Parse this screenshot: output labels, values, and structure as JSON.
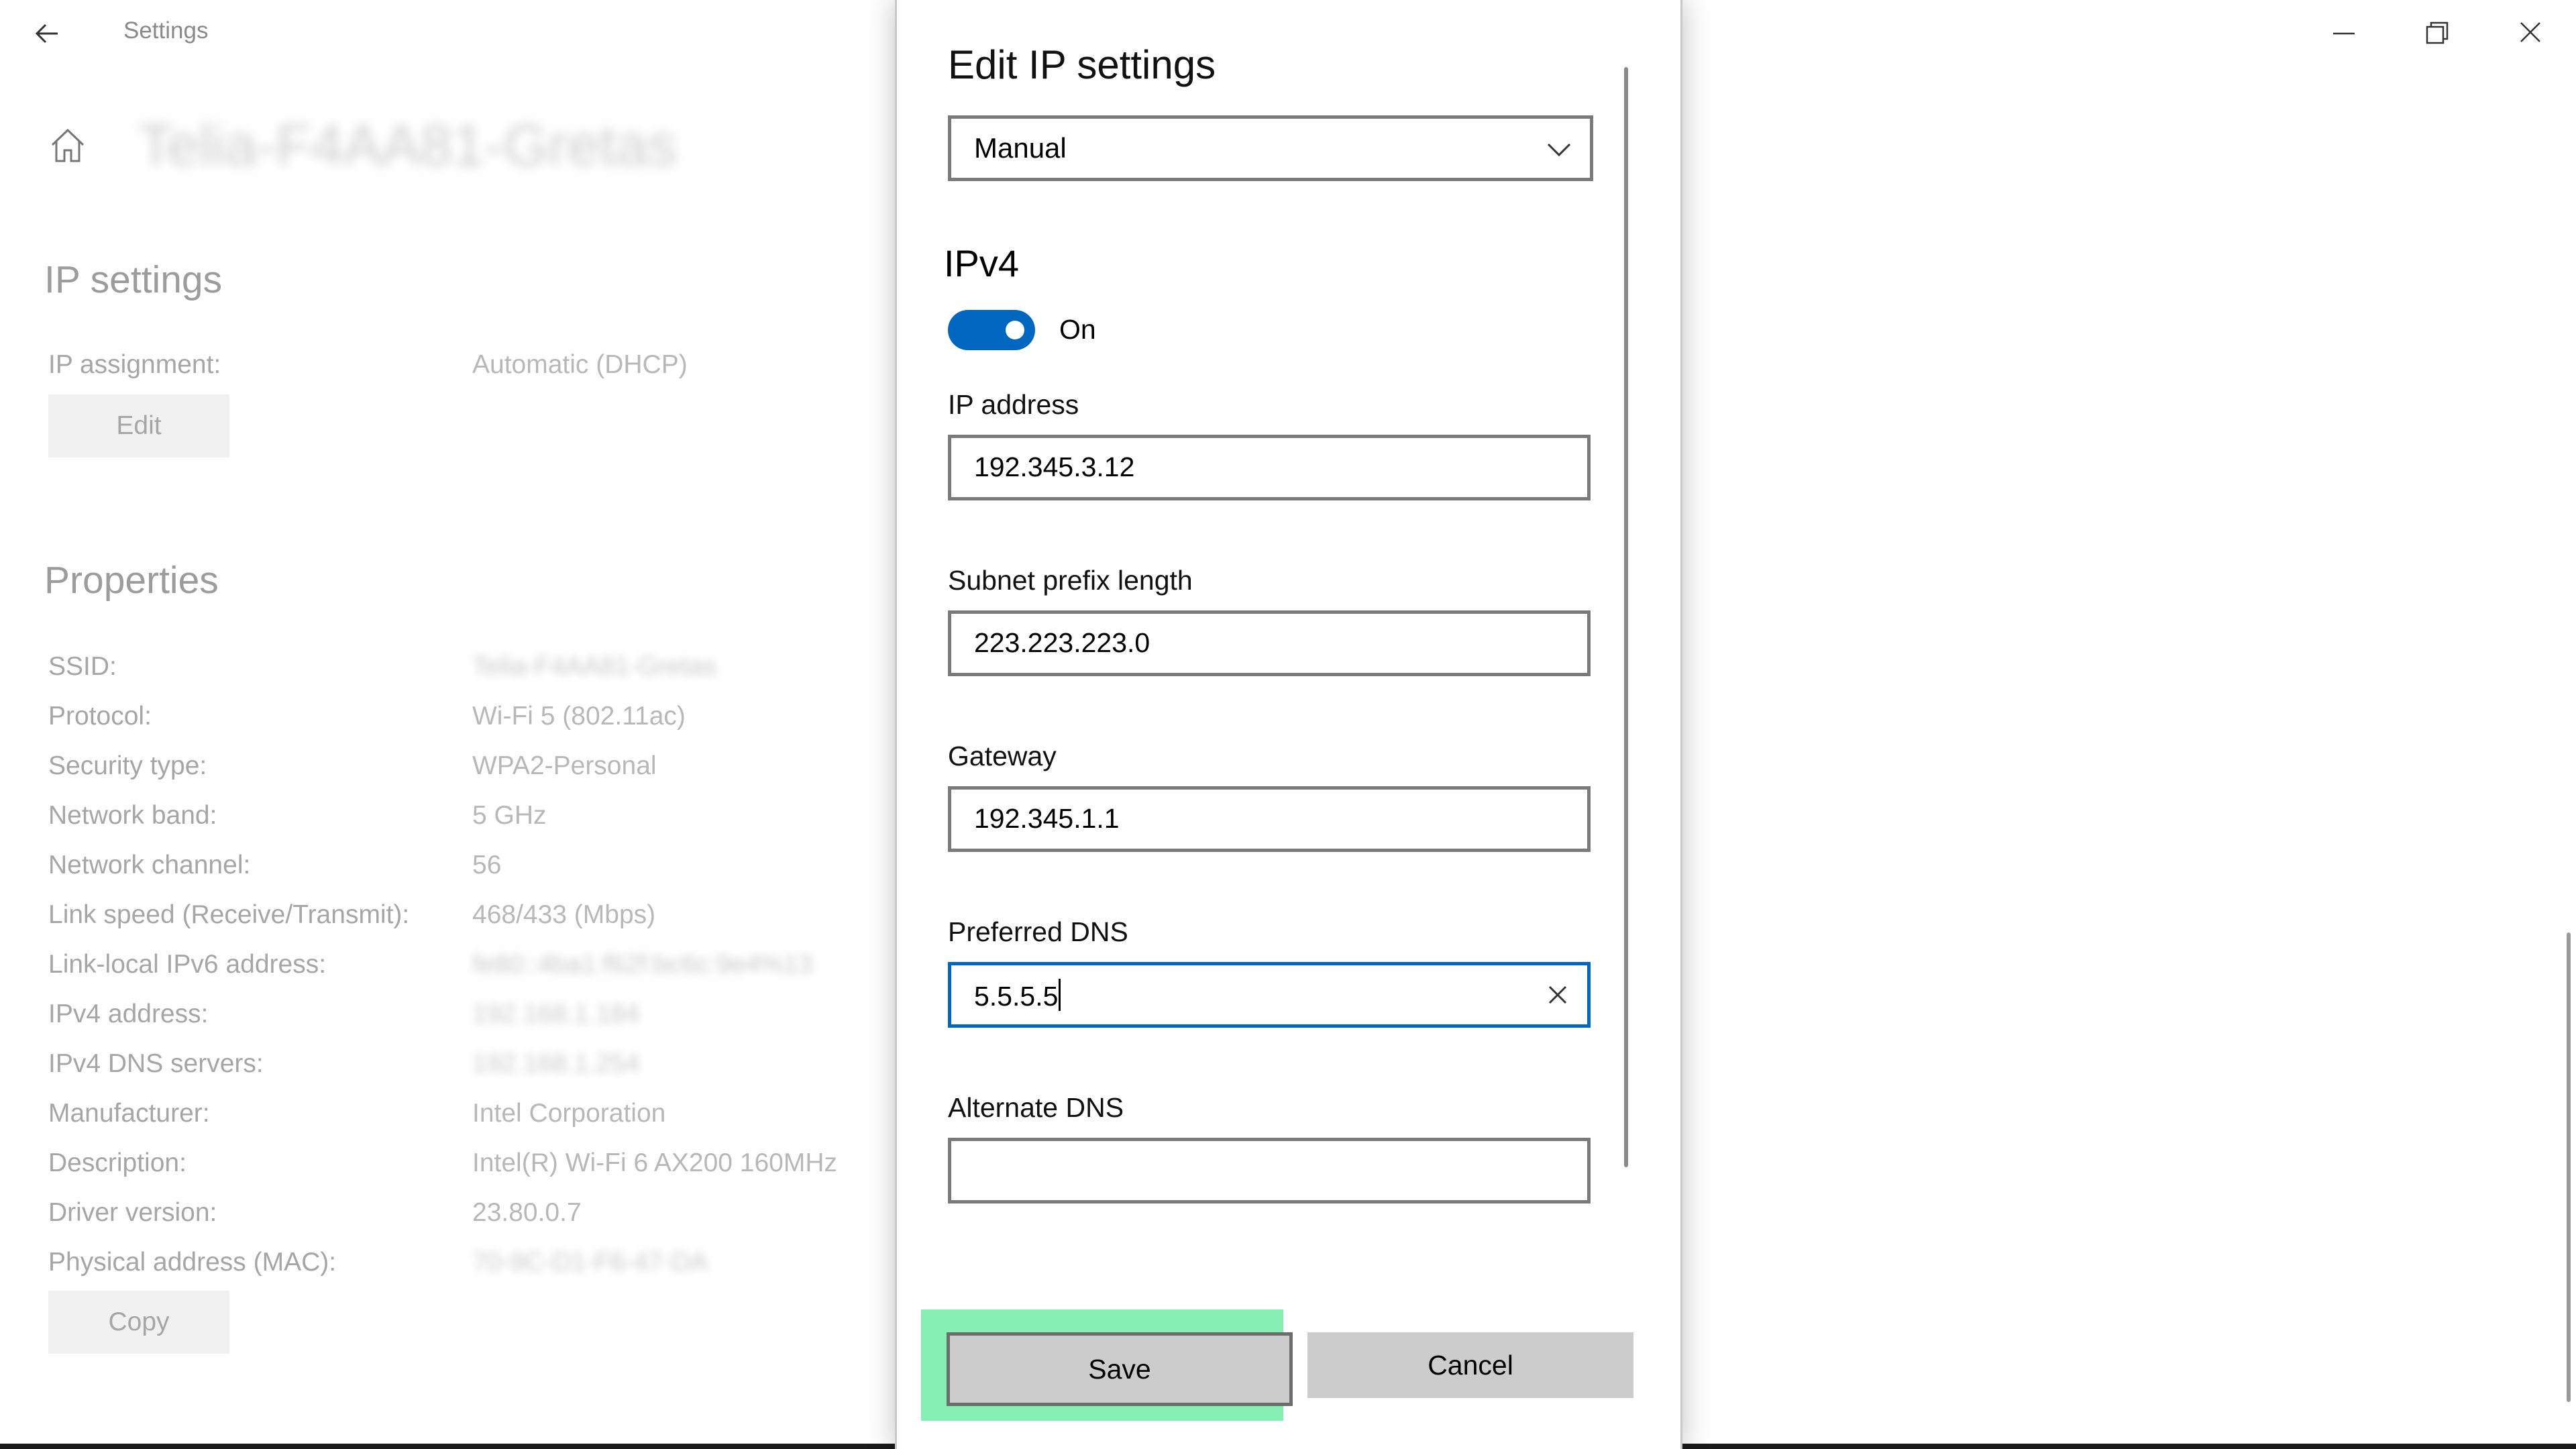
{
  "window": {
    "title": "Settings",
    "network_name_blurred": "Telia-F4AA81-Gretas"
  },
  "ip_settings": {
    "heading": "IP settings",
    "assignment_label": "IP assignment:",
    "assignment_value": "Automatic (DHCP)",
    "edit_label": "Edit"
  },
  "properties": {
    "heading": "Properties",
    "rows": [
      {
        "label": "SSID:",
        "value": "Telia-F4AA81-Gretas"
      },
      {
        "label": "Protocol:",
        "value": "Wi-Fi 5 (802.11ac)"
      },
      {
        "label": "Security type:",
        "value": "WPA2-Personal"
      },
      {
        "label": "Network band:",
        "value": "5 GHz"
      },
      {
        "label": "Network channel:",
        "value": "56"
      },
      {
        "label": "Link speed (Receive/Transmit):",
        "value": "468/433 (Mbps)"
      },
      {
        "label": "Link-local IPv6 address:",
        "value": "fe80::4ba1:f62f:bc6c:9e4%13"
      },
      {
        "label": "IPv4 address:",
        "value": "192.168.1.184"
      },
      {
        "label": "IPv4 DNS servers:",
        "value": "192.168.1.254"
      },
      {
        "label": "Manufacturer:",
        "value": "Intel Corporation"
      },
      {
        "label": "Description:",
        "value": "Intel(R) Wi-Fi 6 AX200 160MHz"
      },
      {
        "label": "Driver version:",
        "value": "23.80.0.7"
      },
      {
        "label": "Physical address (MAC):",
        "value": "70-9C-D1-F6-47-DA"
      }
    ],
    "copy_label": "Copy"
  },
  "dialog": {
    "title": "Edit IP settings",
    "mode_selected": "Manual",
    "ipv4_heading": "IPv4",
    "toggle_state": "On",
    "ip_address": {
      "label": "IP address",
      "value": "192.345.3.12"
    },
    "subnet": {
      "label": "Subnet prefix length",
      "value": "223.223.223.0"
    },
    "gateway": {
      "label": "Gateway",
      "value": "192.345.1.1"
    },
    "preferred_dns": {
      "label": "Preferred DNS",
      "value": "5.5.5.5"
    },
    "alternate_dns": {
      "label": "Alternate DNS",
      "value": ""
    },
    "save_label": "Save",
    "cancel_label": "Cancel"
  },
  "colors": {
    "accent": "#0067c0",
    "highlight": "#86f0b4"
  }
}
